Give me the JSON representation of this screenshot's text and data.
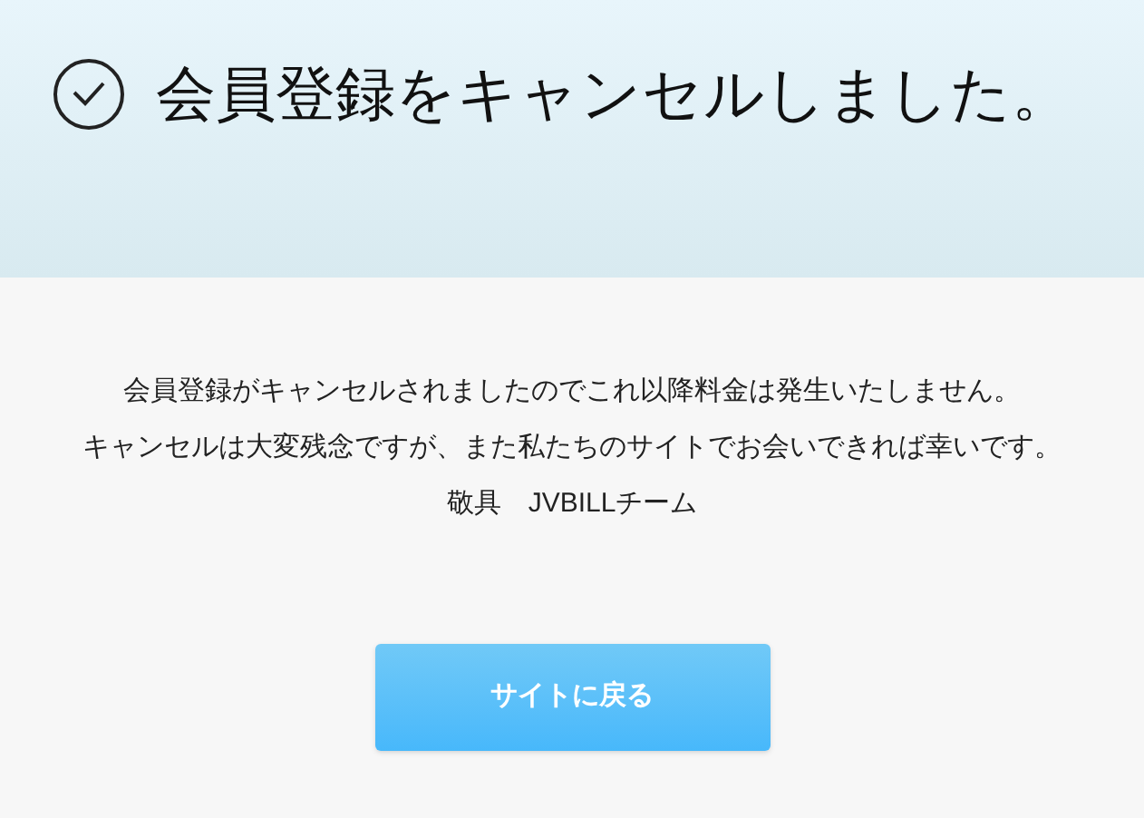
{
  "header": {
    "title": "会員登録をキャンセルしました。"
  },
  "message": {
    "lines": [
      "会員登録がキャンセルされましたのでこれ以降料金は発生いたしません。",
      "キャンセルは大変残念ですが、また私たちのサイトでお会いできれば幸いです。",
      "敬具　JVBILLチーム"
    ]
  },
  "button": {
    "label": "サイトに戻る"
  }
}
